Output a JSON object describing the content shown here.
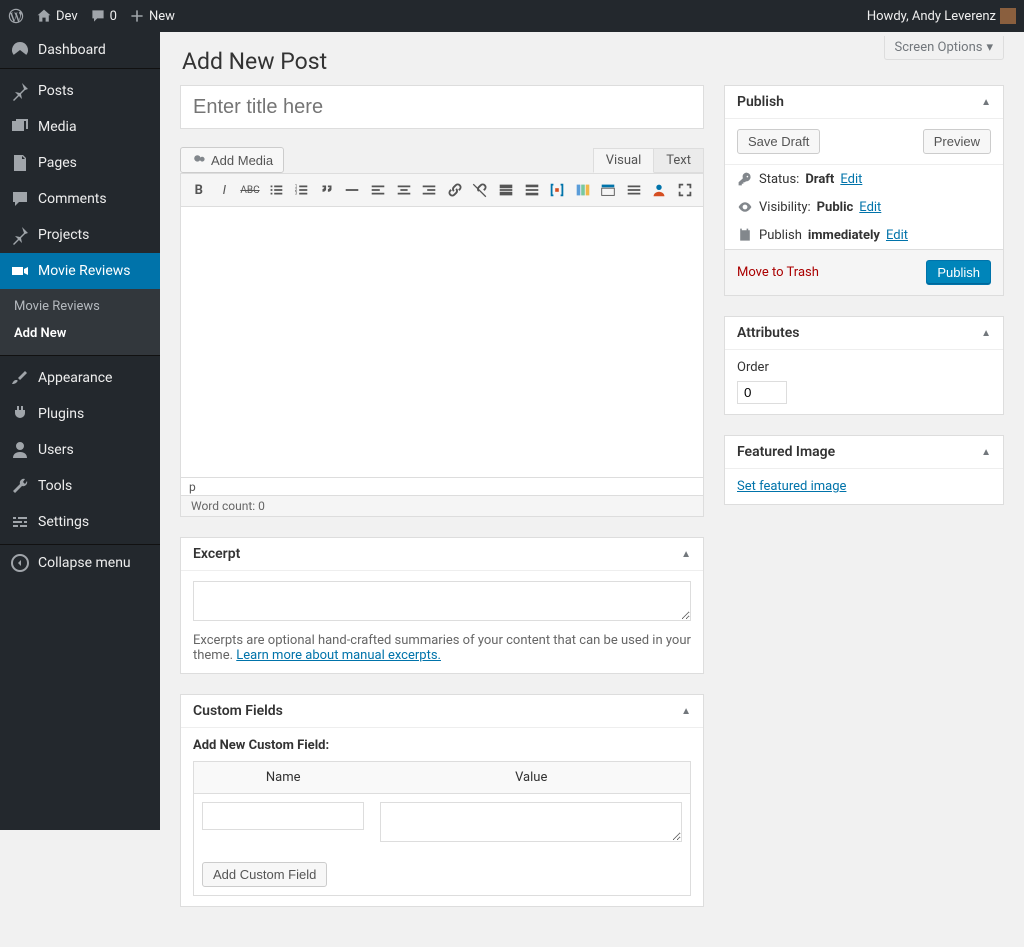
{
  "adminbar": {
    "site_name": "Dev",
    "comments_count": "0",
    "new_label": "New",
    "howdy": "Howdy, Andy Leverenz"
  },
  "sidebar": {
    "items": [
      {
        "key": "dashboard",
        "label": "Dashboard"
      },
      {
        "key": "posts",
        "label": "Posts"
      },
      {
        "key": "media",
        "label": "Media"
      },
      {
        "key": "pages",
        "label": "Pages"
      },
      {
        "key": "comments",
        "label": "Comments"
      },
      {
        "key": "projects",
        "label": "Projects"
      },
      {
        "key": "movie-reviews",
        "label": "Movie Reviews"
      },
      {
        "key": "appearance",
        "label": "Appearance"
      },
      {
        "key": "plugins",
        "label": "Plugins"
      },
      {
        "key": "users",
        "label": "Users"
      },
      {
        "key": "tools",
        "label": "Tools"
      },
      {
        "key": "settings",
        "label": "Settings"
      }
    ],
    "submenu": {
      "items": [
        {
          "label": "Movie Reviews"
        },
        {
          "label": "Add New"
        }
      ]
    },
    "collapse_label": "Collapse menu"
  },
  "screen_options_label": "Screen Options",
  "page_title": "Add New Post",
  "title_placeholder": "Enter title here",
  "add_media_label": "Add Media",
  "tabs": {
    "visual": "Visual",
    "text": "Text"
  },
  "editor": {
    "status_path": "p",
    "word_count_label": "Word count: 0"
  },
  "publish": {
    "title": "Publish",
    "save_draft": "Save Draft",
    "preview": "Preview",
    "status_label": "Status:",
    "status_value": "Draft",
    "visibility_label": "Visibility:",
    "visibility_value": "Public",
    "schedule_label": "Publish",
    "schedule_value": "immediately",
    "edit_label": "Edit",
    "trash_label": "Move to Trash",
    "publish_btn": "Publish"
  },
  "attributes": {
    "title": "Attributes",
    "order_label": "Order",
    "order_value": "0"
  },
  "featured": {
    "title": "Featured Image",
    "set_link": "Set featured image"
  },
  "excerpt": {
    "title": "Excerpt",
    "help_text": "Excerpts are optional hand-crafted summaries of your content that can be used in your theme. ",
    "help_link": "Learn more about manual excerpts."
  },
  "custom_fields": {
    "title": "Custom Fields",
    "add_new_label": "Add New Custom Field:",
    "name_header": "Name",
    "value_header": "Value",
    "add_button": "Add Custom Field"
  }
}
